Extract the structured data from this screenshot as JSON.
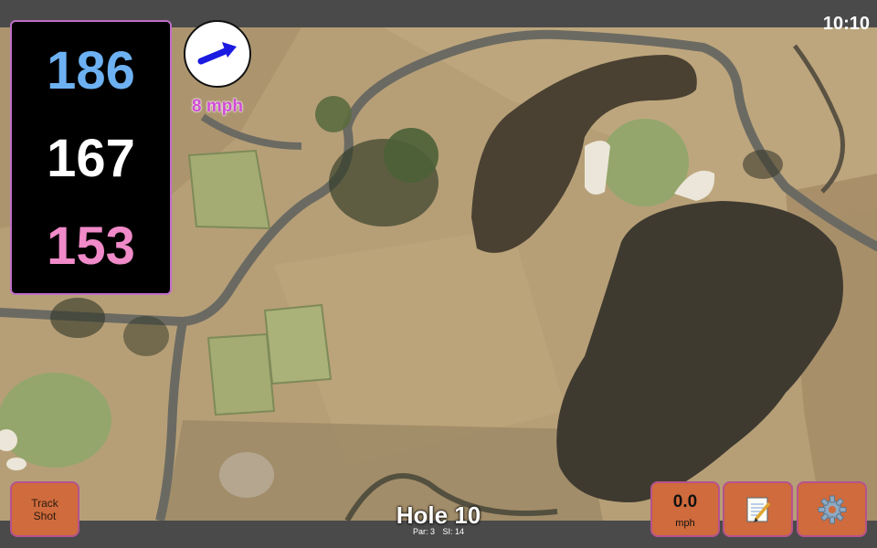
{
  "status_bar": {
    "time": "10:10"
  },
  "distances": {
    "back": "186",
    "middle": "167",
    "front": "153"
  },
  "distance_colors": {
    "back": "#6db1f2",
    "middle": "#ffffff",
    "front": "#f08ac8"
  },
  "wind": {
    "speed_label": "8 mph",
    "icon": "wind-direction-arrow-icon",
    "arrow_color": "#1a1ae0"
  },
  "buttons": {
    "track_shot": {
      "line1": "Track",
      "line2": "Shot"
    },
    "speed": {
      "value": "0.0",
      "unit": "mph"
    },
    "notes": {
      "icon": "notepad-icon"
    },
    "settings": {
      "icon": "gear-icon"
    }
  },
  "hole": {
    "title": "Hole 10",
    "par": "Par: 3",
    "si": "SI: 14"
  },
  "accent_colors": {
    "button_fill": "#cf6b3c",
    "button_border": "#b6538c",
    "panel_border": "#c06ec8"
  }
}
